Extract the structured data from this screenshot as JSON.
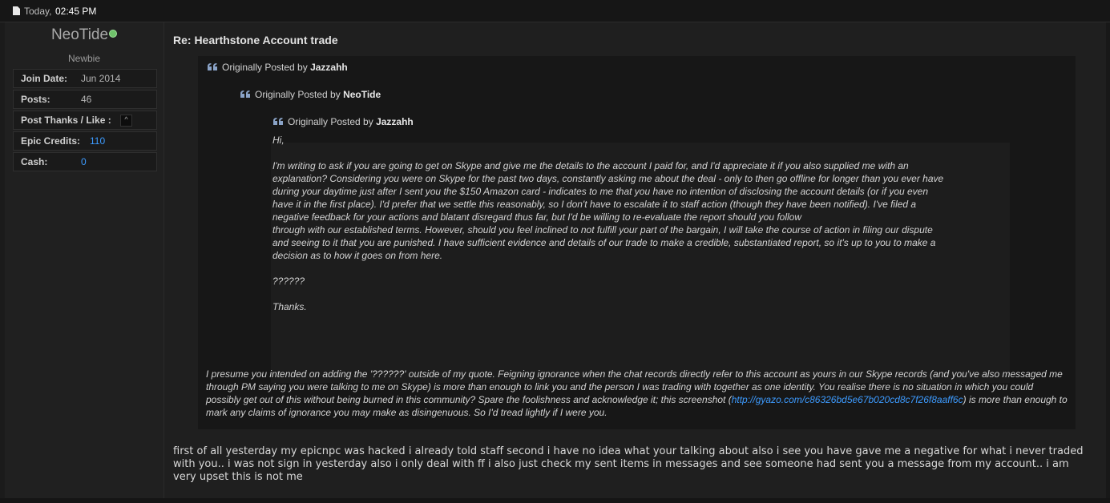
{
  "header": {
    "date": "Today,",
    "time": "02:45 PM"
  },
  "user": {
    "name": "NeoTide",
    "title": "Newbie",
    "stats": [
      {
        "label": "Join Date:",
        "value": "Jun 2014"
      },
      {
        "label": "Posts:",
        "value": "46"
      },
      {
        "label": "Post Thanks / Like :",
        "value": "^"
      },
      {
        "label": "Epic Credits:",
        "value": "110"
      },
      {
        "label": "Cash:",
        "value": "0"
      }
    ]
  },
  "post": {
    "title": "Re: Hearthstone Account trade",
    "quote_prefix": "Originally Posted by",
    "quotes": [
      {
        "author": "Jazzahh"
      },
      {
        "author": "NeoTide"
      },
      {
        "author": "Jazzahh"
      }
    ],
    "inner_quote_text": "Hi,\n\nI'm writing to ask if you are going to get on Skype and give me the details to the account I paid for, and I'd appreciate it if you also supplied me with an\nexplanation? Considering you were on Skype for the past two days, constantly asking me about the deal - only to then go offline for longer than you ever have\nduring your daytime just after I sent you the $150 Amazon card - indicates to me that you have no intention of disclosing the account details (or if you even\nhave it in the first place). I'd prefer that we settle this reasonably, so I don't have to escalate it to staff action (though they have been notified). I've filed a\nnegative feedback for your actions and blatant disregard thus far, but I'd be willing to re-evaluate the report should you follow\nthrough with our established terms. However, should you feel inclined to not fulfill your part of the bargain, I will take the course of action in filing our dispute\nand seeing to it that you are punished. I have sufficient evidence and details of our trade to make a credible, substantiated report, so it's up to you to make a\ndecision as to how it goes on from here.\n\n??????\n\nThanks.",
    "reply_text_a": "I presume you intended on adding the '??????' outside of my quote. Feigning ignorance when the chat records directly refer to this account as yours in our Skype records (and you've also messaged me through PM saying you were talking to me on Skype) is more than enough to link you and the person I was trading with together as one identity. You realise there is no situation in which you could possibly get out of this without being burned in this community? Spare the foolishness and acknowledge it; this screenshot (",
    "reply_link": "http://gyazo.com/c86326bd5e67b020cd8c7f26f8aaff6c",
    "reply_text_b": ") is more than enough to mark any claims of ignorance you may make as disingenuous. So I'd tread lightly if I were you.",
    "body": "first of all yesterday my epicnpc was hacked i already told staff second i have no idea what your talking about also i see you have gave me a negative for what i never traded with you.. i was not sign in yesterday also i only deal with ff i also just check my sent items in messages and see someone had sent you a message from my account.. i am very upset this is not me"
  },
  "colors": {
    "background": "#1b1b1b",
    "link": "#3d9bff",
    "online": "#6fc16a"
  },
  "icons": [
    "document-icon",
    "quote-icon",
    "online-status-icon",
    "collapse-icon"
  ]
}
